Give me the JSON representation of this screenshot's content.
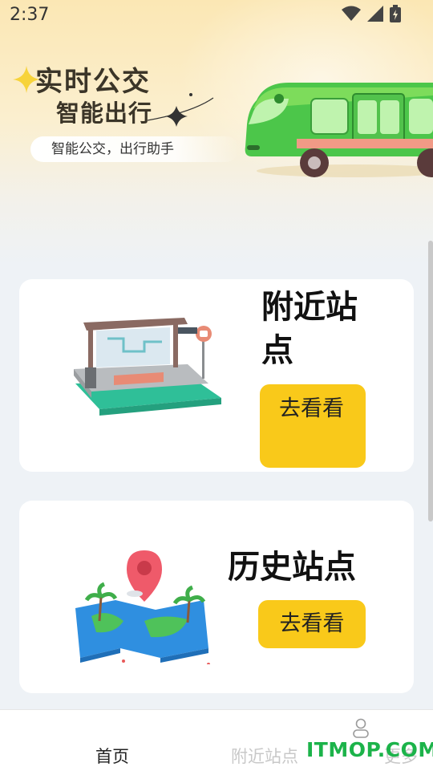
{
  "status": {
    "time": "2:37"
  },
  "hero": {
    "title": "实时公交",
    "subtitle": "智能出行",
    "tagline": "智能公交，出行助手"
  },
  "cards": [
    {
      "title": "附近站点",
      "button": "去看看",
      "illustration": "bus-stop-icon"
    },
    {
      "title": "历史站点",
      "button": "去看看",
      "illustration": "map-pin-icon"
    }
  ],
  "tabs": [
    {
      "label": "首页",
      "active": true
    },
    {
      "label": "附近站点",
      "active": false
    },
    {
      "label": "更多",
      "active": false,
      "icon": "user-icon"
    }
  ],
  "watermark": "ITMOP.COM",
  "colors": {
    "accent": "#f9c91a",
    "bus": "#4cc64a",
    "watermark": "#1cb34a"
  }
}
